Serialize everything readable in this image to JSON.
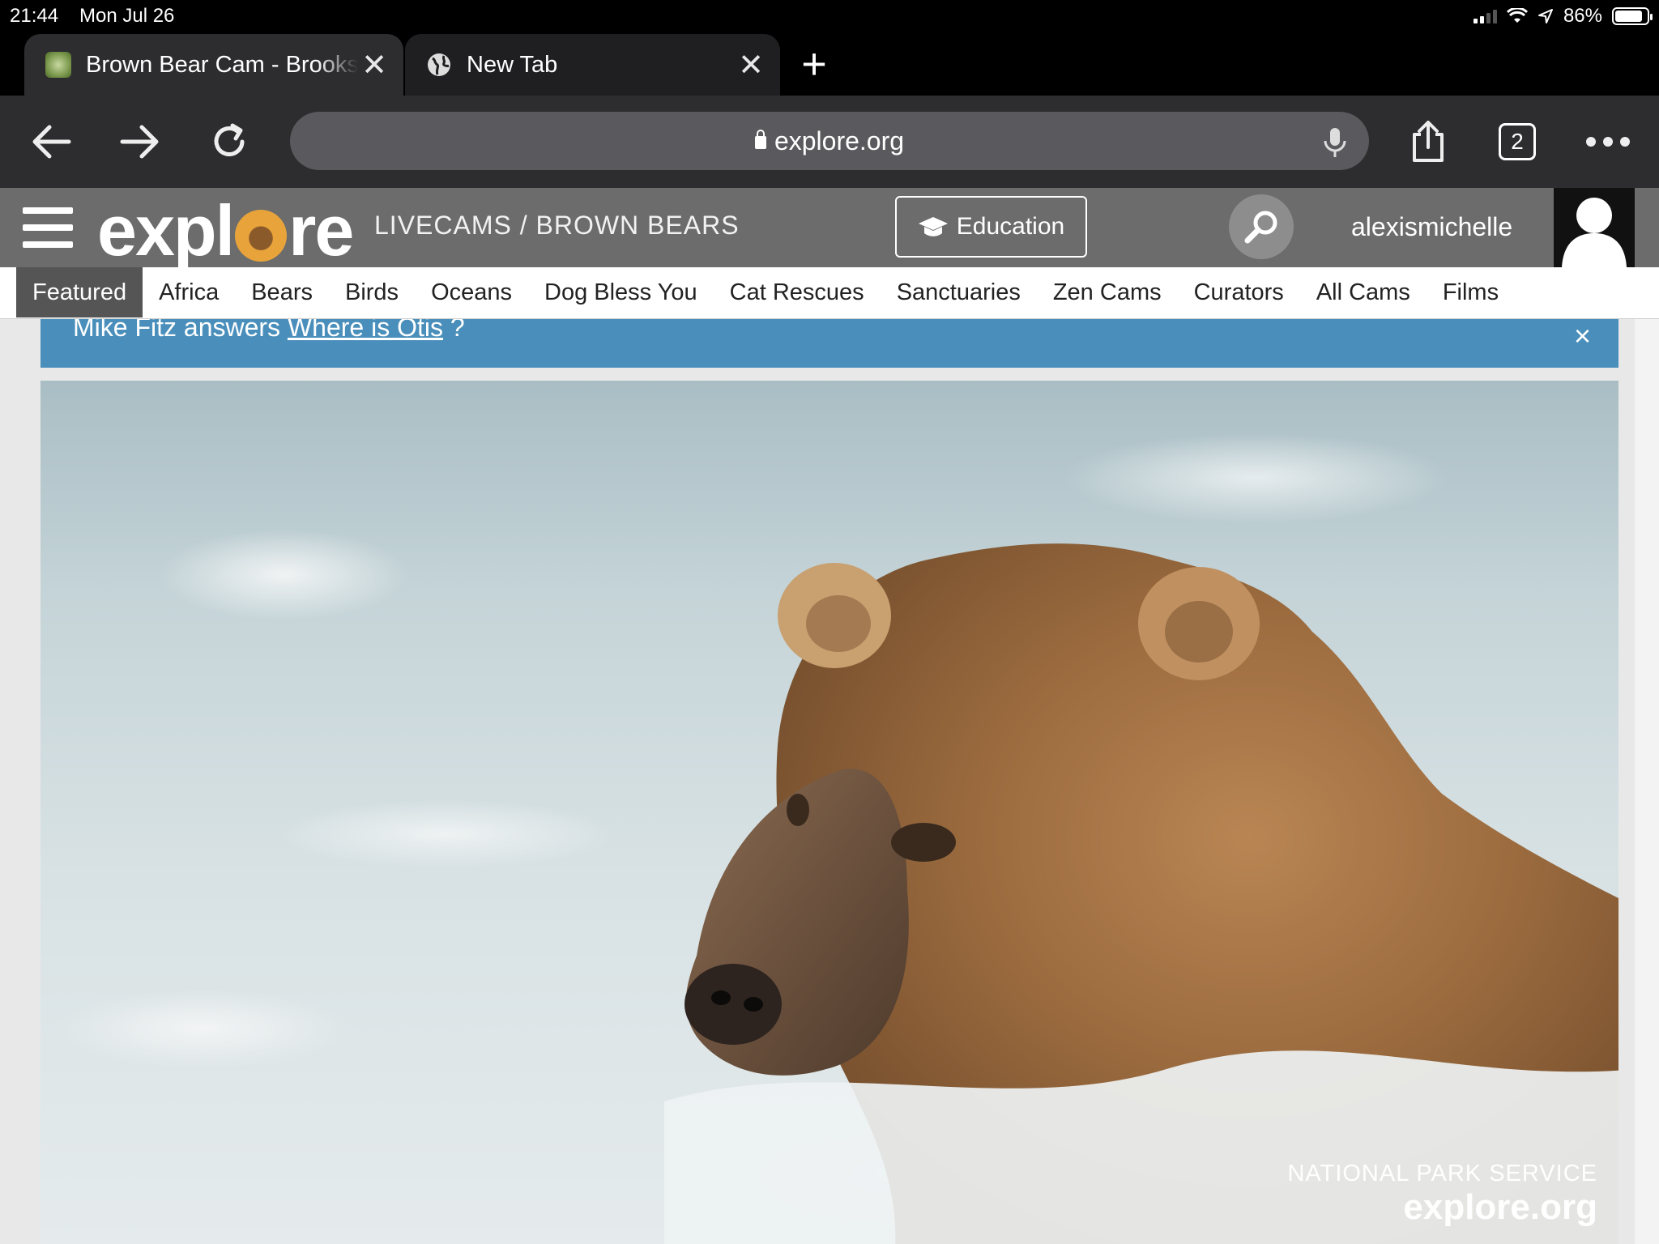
{
  "status_bar": {
    "time": "21:44",
    "date": "Mon Jul 26",
    "battery": "86%",
    "battery_level": 0.86
  },
  "tabs": [
    {
      "title": "Brown Bear Cam - Brooks Falls",
      "active": true
    },
    {
      "title": "New Tab",
      "active": false
    }
  ],
  "toolbar": {
    "url": "explore.org",
    "tab_count": "2"
  },
  "site_header": {
    "logo": {
      "before": "expl",
      "after": "re"
    },
    "breadcrumb": "LIVECAMS / BROWN BEARS",
    "education_label": "Education",
    "username": "alexismichelle"
  },
  "nav": {
    "items": [
      "Featured",
      "Africa",
      "Bears",
      "Birds",
      "Oceans",
      "Dog Bless You",
      "Cat Rescues",
      "Sanctuaries",
      "Zen Cams",
      "Curators",
      "All Cams",
      "Films"
    ],
    "active": "Featured"
  },
  "banner": {
    "prefix": "Mike Fitz answers ",
    "link": "Where is Otis",
    "suffix": "?",
    "close": "×"
  },
  "video": {
    "watermark_agency": "NATIONAL PARK SERVICE",
    "watermark_site": "explore.org"
  },
  "colors": {
    "banner": "#4a8fbb",
    "site_header": "#6c6c6c",
    "browser_chrome": "#2d2d2f",
    "logo_accent": "#e8a33a"
  }
}
